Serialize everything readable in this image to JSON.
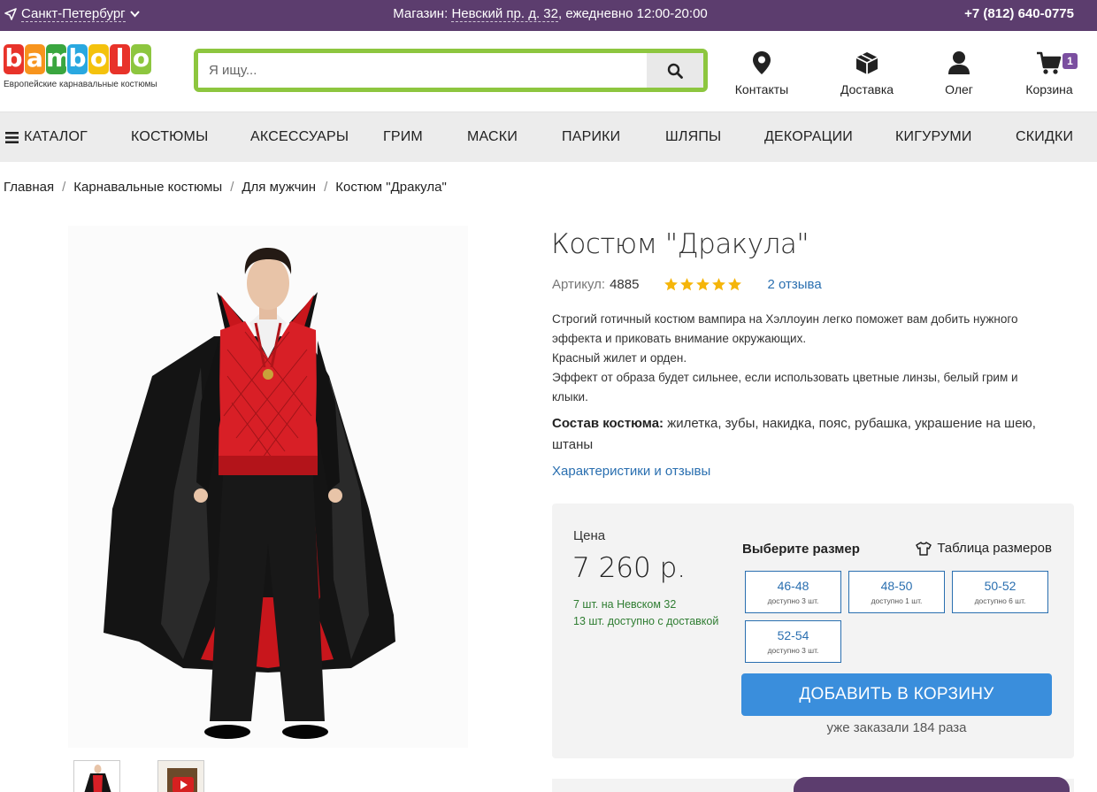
{
  "topbar": {
    "city": "Санкт-Петербург",
    "store_prefix": "Магазин:",
    "store_address": "Невский пр. д. 32",
    "store_hours": ", ежедневно 12:00-20:00",
    "phone": "+7 (812) 640-0775"
  },
  "logo": {
    "letters": [
      "b",
      "a",
      "m",
      "b",
      "o",
      "l",
      "o"
    ],
    "letter_colors": [
      "#e8332a",
      "#f7941d",
      "#3aa63f",
      "#29a8e0",
      "#f4c20d",
      "#e8332a",
      "#8dc63f"
    ],
    "tagline": "Европейские карнавальные костюмы"
  },
  "search": {
    "placeholder": "Я ищу..."
  },
  "header_links": {
    "contacts": "Контакты",
    "delivery": "Доставка",
    "user": "Олег",
    "cart": "Корзина",
    "cart_count": "1"
  },
  "nav": {
    "catalog": "КАТАЛОГ",
    "items": [
      "КОСТЮМЫ",
      "АКСЕССУАРЫ",
      "ГРИМ",
      "МАСКИ",
      "ПАРИКИ",
      "ШЛЯПЫ",
      "ДЕКОРАЦИИ",
      "КИГУРУМИ",
      "СКИДКИ"
    ]
  },
  "breadcrumb": [
    "Главная",
    "Карнавальные костюмы",
    "Для мужчин",
    "Костюм \"Дракула\""
  ],
  "product": {
    "title": "Костюм \"Дракула\"",
    "article_label": "Артикул:",
    "article": "4885",
    "rating": 5,
    "reviews": "2 отзыва",
    "description": "Строгий готичный костюм вампира на Хэллоуин легко поможет вам добить нужного\nэффекта и приковать внимание окружающих.\n Красный жилет и орден.\nЭффект от образа будет сильнее, если использовать цветные линзы, белый грим и\nклыки.",
    "composition_label": "Состав костюма:",
    "composition": " жилетка, зубы, накидка, пояс, рубашка, украшение на шею, штаны",
    "characteristics_link": "Характеристики и отзывы"
  },
  "purchase": {
    "price_label": "Цена",
    "price": "7 260 р.",
    "stock_store": "7 шт. на Невском 32",
    "stock_delivery": "13 шт. доступно с доставкой",
    "size_title": "Выберите размер",
    "size_table": "Таблица размеров",
    "sizes": [
      {
        "size": "46-48",
        "avail": "доступно 3 шт."
      },
      {
        "size": "48-50",
        "avail": "доступно 1 шт."
      },
      {
        "size": "50-52",
        "avail": "доступно 6 шт."
      },
      {
        "size": "52-54",
        "avail": "доступно 3 шт."
      }
    ],
    "add_to_cart": "ДОБАВИТЬ В КОРЗИНУ",
    "ordered": "уже заказали 184 раза"
  },
  "colors": {
    "topbar": "#5c3d6e",
    "search_border": "#8dc63f",
    "link": "#2a6fb0",
    "button": "#3a8edc",
    "stock": "#2f7d32",
    "star": "#f5b50a"
  }
}
